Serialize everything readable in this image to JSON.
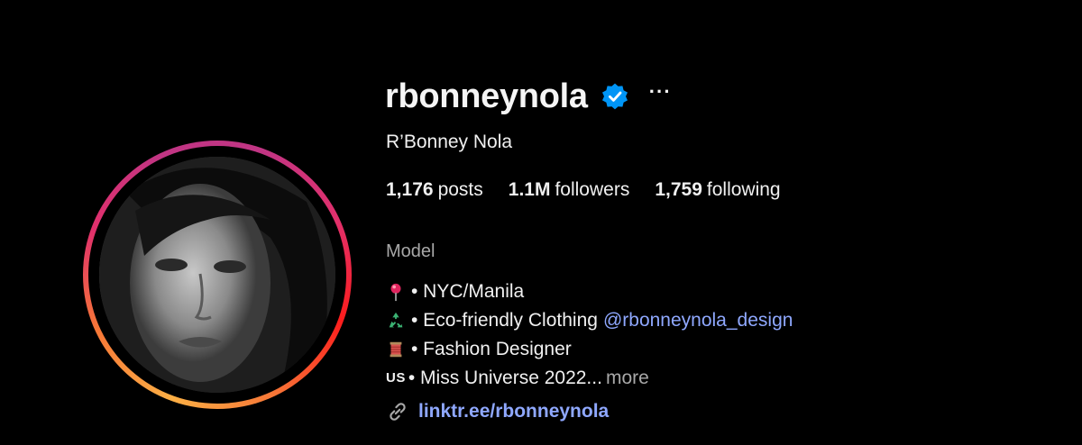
{
  "profile": {
    "username": "rbonneynola",
    "full_name": "R’Bonney Nola",
    "verified_icon": "verified-badge-icon",
    "more_label": "···",
    "stats": {
      "posts_count": "1,176",
      "posts_label": "posts",
      "followers_count": "1.1M",
      "followers_label": "followers",
      "following_count": "1,759",
      "following_label": "following"
    },
    "category": "Model",
    "bio": {
      "line1": "• NYC/Manila",
      "line1_icon": "pin-icon",
      "line2": "• Eco-friendly Clothing",
      "line2_icon": "recycle-icon",
      "line2_mention": "@rbonneynola_design",
      "line3": "• Fashion Designer",
      "line3_icon": "thread-icon",
      "line4_flag": "US",
      "line4": "• Miss Universe 2022...",
      "line4_more": "more"
    },
    "link_text": "linktr.ee/rbonneynola",
    "link_icon": "link-icon"
  },
  "colors": {
    "background": "#000000",
    "text": "#f5f5f5",
    "secondary_text": "#a8a8a8",
    "link": "#8fa8ff",
    "verified": "#0095f6"
  }
}
